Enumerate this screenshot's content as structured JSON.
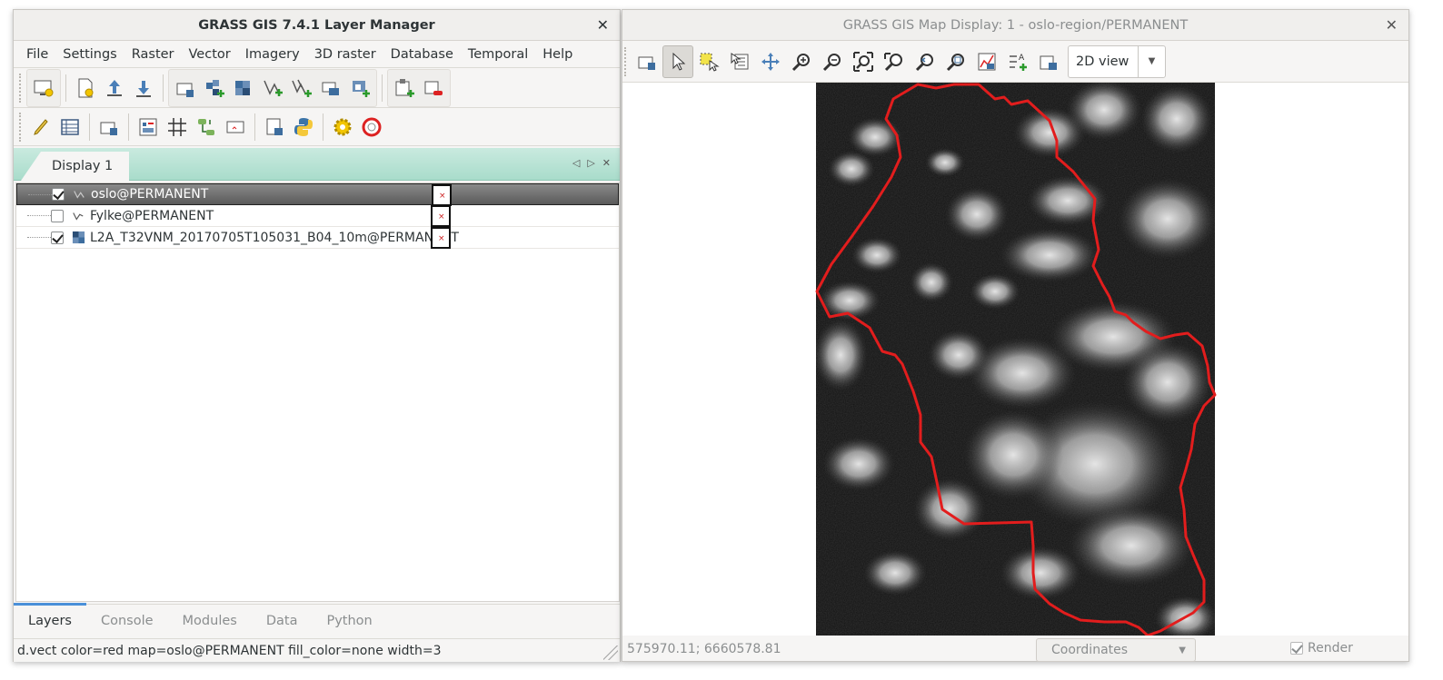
{
  "layer_manager": {
    "title": "GRASS GIS 7.4.1 Layer Manager",
    "menu": [
      "File",
      "Settings",
      "Raster",
      "Vector",
      "Imagery",
      "3D raster",
      "Database",
      "Temporal",
      "Help"
    ],
    "display_tab": "Display 1",
    "layers": [
      {
        "name": "oslo@PERMANENT",
        "checked": true,
        "type": "vector",
        "selected": true
      },
      {
        "name": "Fylke@PERMANENT",
        "checked": false,
        "type": "vector",
        "selected": false
      },
      {
        "name": "L2A_T32VNM_20170705T105031_B04_10m@PERMANENT",
        "checked": true,
        "type": "raster",
        "selected": false
      }
    ],
    "bottom_tabs": [
      "Layers",
      "Console",
      "Modules",
      "Data",
      "Python"
    ],
    "active_bottom_tab": "Layers",
    "status": "d.vect color=red map=oslo@PERMANENT fill_color=none width=3"
  },
  "map_display": {
    "title": "GRASS GIS Map Display: 1 - oslo-region/PERMANENT",
    "view_mode": "2D view",
    "coordinates": "575970.11; 6660578.81",
    "coord_select": "Coordinates",
    "render_label": "Render",
    "render_checked": true,
    "boundary_color": "#e21d1d"
  },
  "icons": {
    "lm_toolbar1": [
      "new-display-icon",
      "new-workspace-icon",
      "open-workspace-icon",
      "save-workspace-icon",
      "add-raster-icon",
      "add-multiple-rasters-icon",
      "add-raster-overlay-icon",
      "add-vector-icon",
      "add-multiple-vectors-icon",
      "add-vector-overlay-icon",
      "add-group-icon",
      "add-overlay-icon",
      "remove-layer-icon"
    ],
    "lm_toolbar2": [
      "vector-digitizer-icon",
      "attribute-table-icon",
      "georectifier-icon",
      "cartographic-composer-icon",
      "grid-icon",
      "graphical-modeler-icon",
      "map-swipe-icon",
      "script-icon",
      "python-icon",
      "settings-icon",
      "help-icon"
    ],
    "map_toolbar": [
      "display-map-icon",
      "pointer-icon",
      "select-icon",
      "query-icon",
      "pan-icon",
      "zoom-in-icon",
      "zoom-out-icon",
      "zoom-extent-icon",
      "zoom-back-icon",
      "zoom-menu-icon",
      "zoom-region-icon",
      "analyze-icon",
      "decoration-icon",
      "save-image-icon"
    ]
  }
}
